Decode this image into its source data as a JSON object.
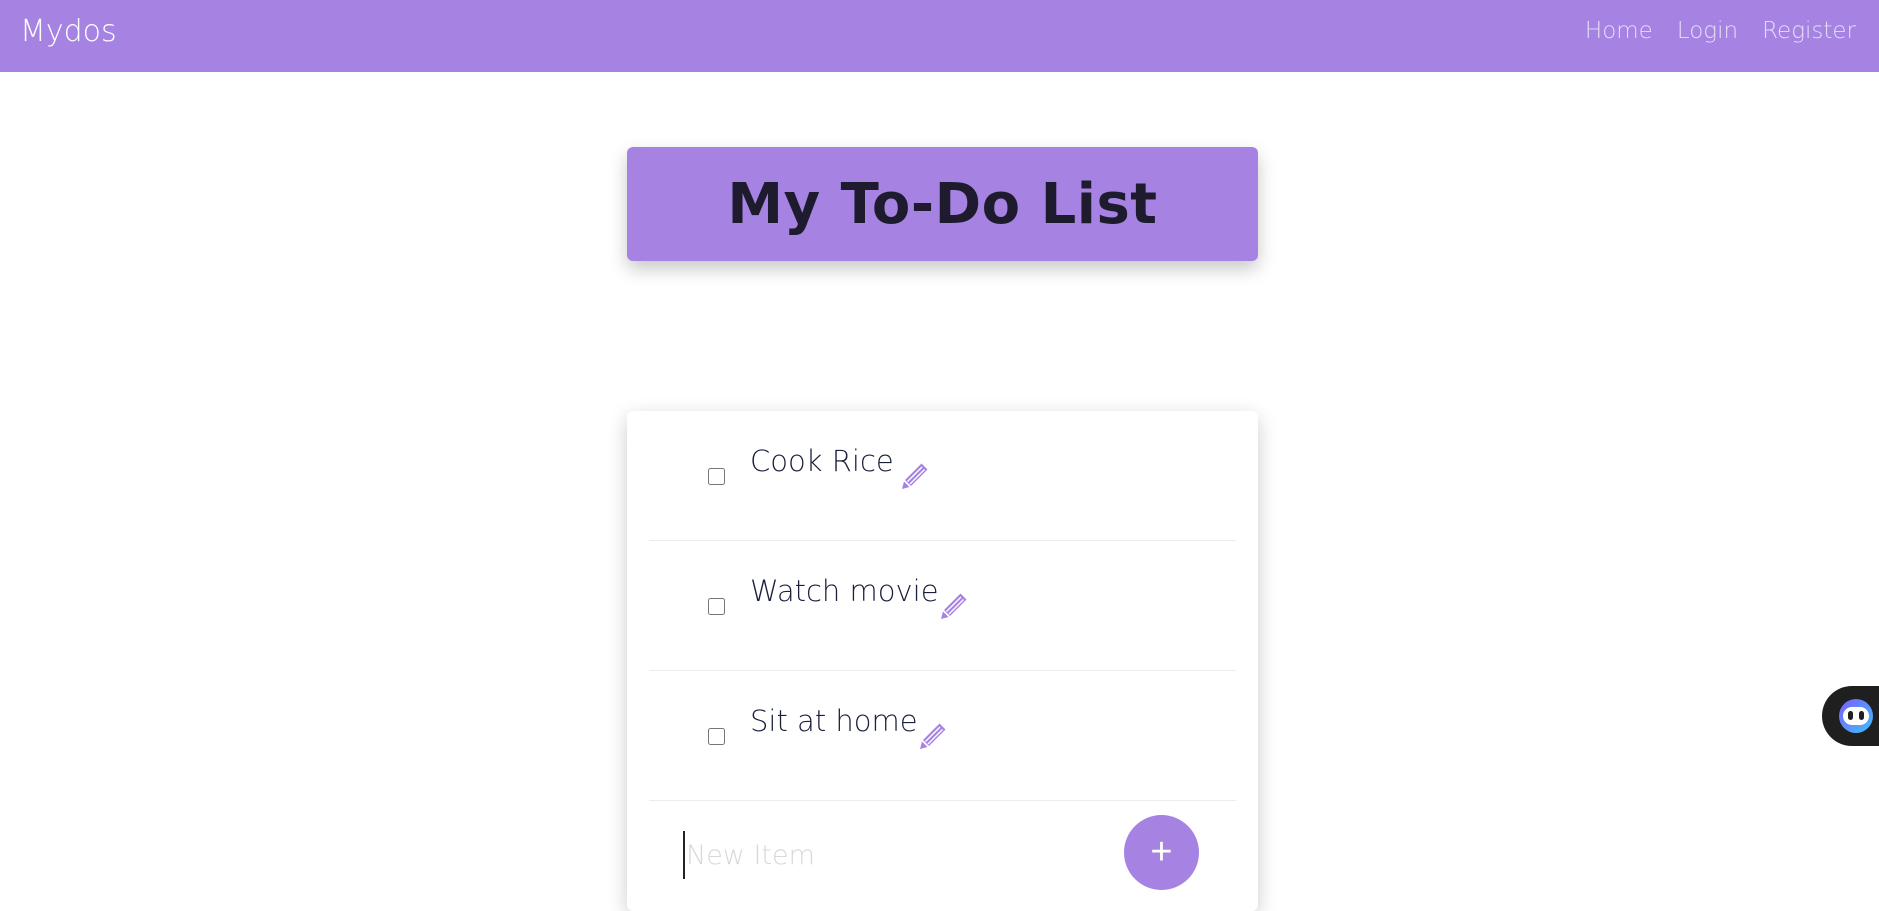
{
  "navbar": {
    "brand": "Mydos",
    "links": [
      "Home",
      "Login",
      "Register"
    ],
    "color": "#a683e3"
  },
  "heading": {
    "title": "My To-Do List"
  },
  "todos": {
    "items": [
      {
        "label": "Cook Rice",
        "checked": false,
        "edit_icon": "pencil-icon"
      },
      {
        "label": "Watch movie",
        "checked": false,
        "edit_icon": "pencil-icon"
      },
      {
        "label": "Sit at home",
        "checked": false,
        "edit_icon": "pencil-icon"
      }
    ],
    "new_item": {
      "placeholder": "New Item",
      "value": ""
    },
    "add_button": {
      "label": "+"
    }
  },
  "widget": {
    "icon": "assistant-face-icon"
  }
}
